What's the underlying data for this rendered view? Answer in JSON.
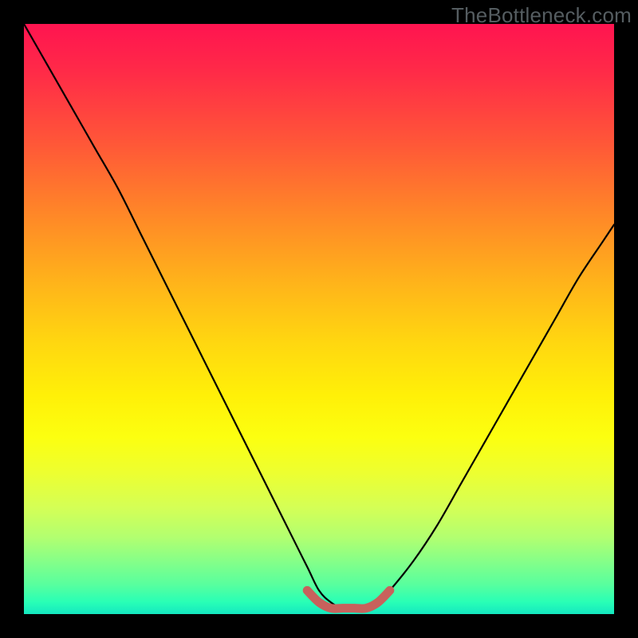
{
  "watermark": "TheBottleneck.com",
  "chart_data": {
    "type": "line",
    "title": "",
    "xlabel": "",
    "ylabel": "",
    "xlim": [
      0,
      100
    ],
    "ylim": [
      0,
      100
    ],
    "series": [
      {
        "name": "bottleneck-curve",
        "x": [
          0,
          4,
          8,
          12,
          16,
          20,
          24,
          28,
          32,
          36,
          40,
          44,
          48,
          50,
          52,
          54,
          56,
          58,
          60,
          62,
          66,
          70,
          74,
          78,
          82,
          86,
          90,
          94,
          98,
          100
        ],
        "values": [
          100,
          93,
          86,
          79,
          72,
          64,
          56,
          48,
          40,
          32,
          24,
          16,
          8,
          4,
          2,
          1,
          1,
          1,
          2,
          4,
          9,
          15,
          22,
          29,
          36,
          43,
          50,
          57,
          63,
          66
        ]
      },
      {
        "name": "optimal-band",
        "x": [
          48,
          50,
          52,
          54,
          56,
          58,
          60,
          62
        ],
        "values": [
          4,
          2,
          1,
          1,
          1,
          1,
          2,
          4
        ]
      }
    ],
    "colors": {
      "curve_stroke": "#000000",
      "band_stroke": "#c8615c"
    }
  }
}
